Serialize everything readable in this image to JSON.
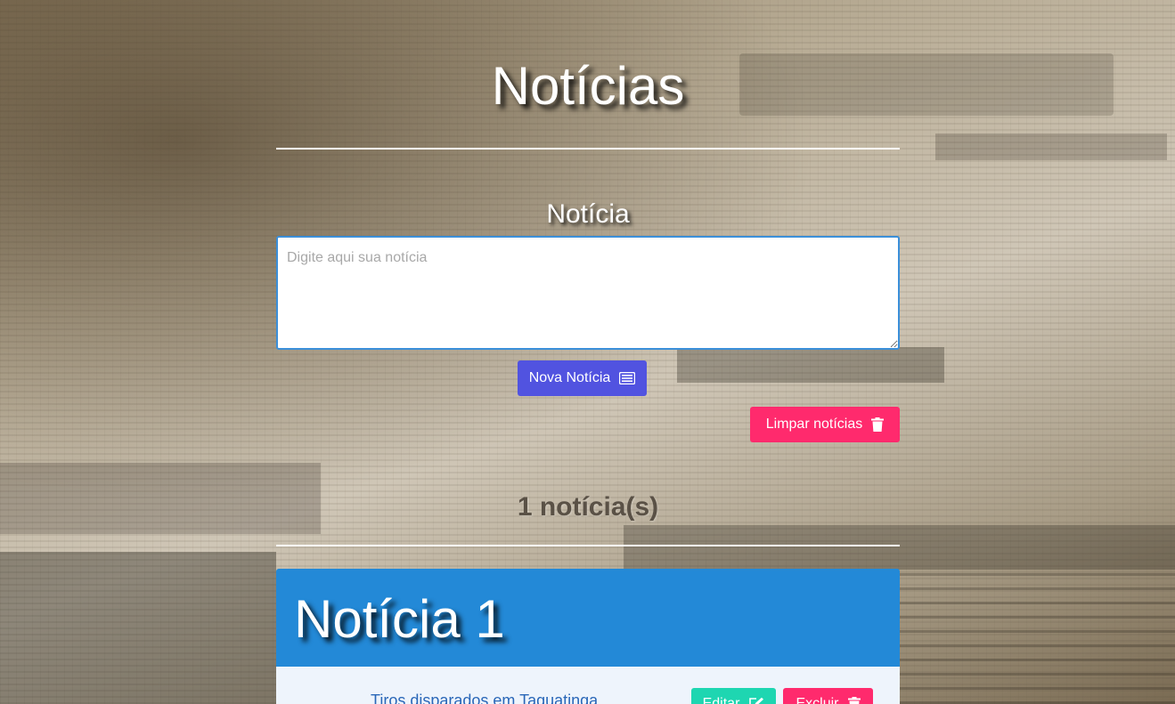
{
  "header": {
    "title": "Notícias"
  },
  "form": {
    "label": "Notícia",
    "textarea_placeholder": "Digite aqui sua notícia",
    "new_button_label": "Nova Notícia",
    "new_button_icon": "newspaper-icon",
    "clear_button_label": "Limpar notícias",
    "clear_button_icon": "trash-icon"
  },
  "list": {
    "count_label": "1 notícia(s)",
    "items": [
      {
        "title": "Notícia 1",
        "text": "Tiros disparados em Taguatinga",
        "edit_label": "Editar",
        "edit_icon": "edit-icon",
        "delete_label": "Excluir",
        "delete_icon": "trash-icon"
      }
    ]
  },
  "colors": {
    "primary_button": "#5153e0",
    "danger_button": "#ff2a6d",
    "success_button": "#1ed6b1",
    "card_header": "#2389d7",
    "card_body": "#eef4fc"
  }
}
